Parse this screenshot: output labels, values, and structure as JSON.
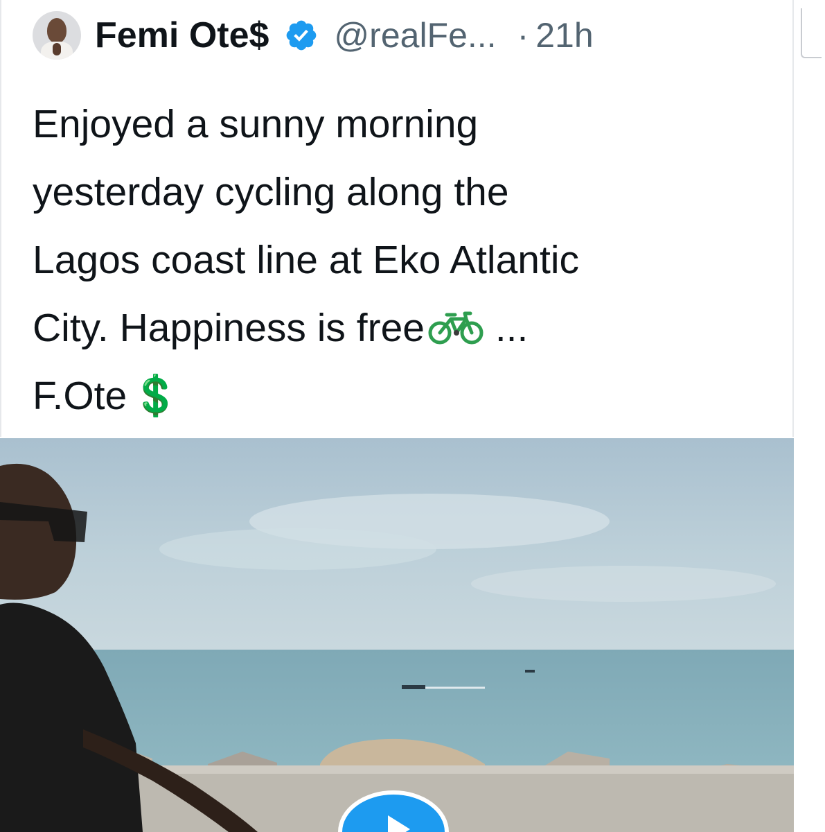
{
  "tweet": {
    "author": {
      "display_name": "Femi Ote$",
      "handle": "@realFe...",
      "verified": true,
      "avatar_icon": "profile-photo"
    },
    "separator": "·",
    "time": "21h",
    "text_lines": [
      "Enjoyed a sunny morning",
      "yesterday cycling along the",
      "Lagos coast line at Eko Atlantic",
      "City. Happiness is free",
      "F.Ote"
    ],
    "text_line4_suffix": " ...",
    "emojis": {
      "bicycle": "🚲",
      "dollar": "💲"
    },
    "media": {
      "type": "video",
      "icon": "play-icon"
    }
  },
  "colors": {
    "text": "#0f1419",
    "secondary": "#536471",
    "verified": "#1d9bf0",
    "play_button": "#1d9bf0",
    "dollar": "#1f9d3a",
    "bicycle": "#2e9e4f"
  }
}
